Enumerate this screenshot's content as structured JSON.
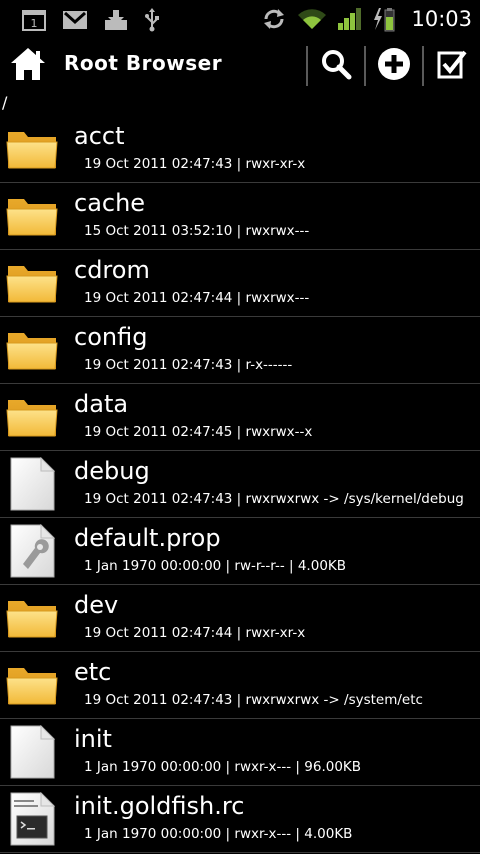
{
  "status_bar": {
    "time": "10:03",
    "notification_icons": [
      "calendar-icon",
      "gmail-icon",
      "download-icon",
      "usb-icon"
    ],
    "system_icons": [
      "sync-icon",
      "wifi-icon",
      "signal-icon",
      "battery-charging-icon"
    ]
  },
  "app_bar": {
    "title": "Root Browser",
    "actions": [
      "search-icon",
      "add-icon",
      "multiselect-icon"
    ]
  },
  "path": "/",
  "files": [
    {
      "name": "acct",
      "meta": "19 Oct 2011 02:47:43 | rwxr-xr-x",
      "icon": "folder-icon"
    },
    {
      "name": "cache",
      "meta": "15 Oct 2011 03:52:10 | rwxrwx---",
      "icon": "folder-icon"
    },
    {
      "name": "cdrom",
      "meta": "19 Oct 2011 02:47:44 | rwxrwx---",
      "icon": "folder-icon"
    },
    {
      "name": "config",
      "meta": "19 Oct 2011 02:47:43 | r-x------",
      "icon": "folder-icon"
    },
    {
      "name": "data",
      "meta": "19 Oct 2011 02:47:45 | rwxrwx--x",
      "icon": "folder-icon"
    },
    {
      "name": "debug",
      "meta": "19 Oct 2011 02:47:43 | rwxrwxrwx -> /sys/kernel/debug",
      "icon": "file-icon"
    },
    {
      "name": "default.prop",
      "meta": "1 Jan 1970 00:00:00 | rw-r--r-- | 4.00KB",
      "icon": "settings-file-icon"
    },
    {
      "name": "dev",
      "meta": "19 Oct 2011 02:47:44 | rwxr-xr-x",
      "icon": "folder-icon"
    },
    {
      "name": "etc",
      "meta": "19 Oct 2011 02:47:43 | rwxrwxrwx -> /system/etc",
      "icon": "folder-icon"
    },
    {
      "name": "init",
      "meta": "1 Jan 1970 00:00:00 | rwxr-x--- | 96.00KB",
      "icon": "file-icon"
    },
    {
      "name": "init.goldfish.rc",
      "meta": "1 Jan 1970 00:00:00 | rwxr-x--- | 4.00KB",
      "icon": "script-file-icon"
    }
  ],
  "colors": {
    "background": "#000000",
    "folder": "#f3c04a",
    "divider": "#3a3a3a",
    "wifi_signal": "#8ec43e"
  }
}
